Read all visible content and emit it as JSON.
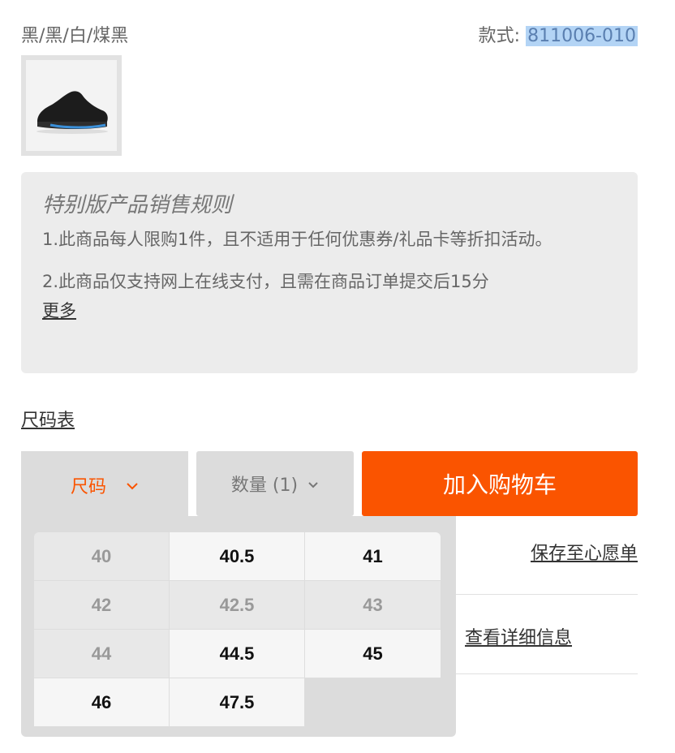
{
  "product": {
    "colorway": "黑/黑/白/煤黑",
    "style_label": "款式: ",
    "style_code": "811006-010"
  },
  "rules": {
    "title": "特别版产品销售规则",
    "items": [
      "1.此商品每人限购1件，且不适用于任何优惠券/礼品卡等折扣活动。",
      "2.此商品仅支持网上在线支付，且需在商品订单提交后15分"
    ],
    "more_label": "更多"
  },
  "size_chart_label": "尺码表",
  "controls": {
    "size_label": "尺码",
    "quantity_label": "数量 (1)",
    "add_to_cart_label": "加入购物车",
    "accent_color": "#fa5400"
  },
  "links": {
    "wishlist": "保存至心愿单",
    "details": "查看详细信息"
  },
  "sizes": [
    {
      "label": "40",
      "available": false
    },
    {
      "label": "40.5",
      "available": true
    },
    {
      "label": "41",
      "available": true
    },
    {
      "label": "42",
      "available": false
    },
    {
      "label": "42.5",
      "available": false
    },
    {
      "label": "43",
      "available": false
    },
    {
      "label": "44",
      "available": false
    },
    {
      "label": "44.5",
      "available": true
    },
    {
      "label": "45",
      "available": true
    },
    {
      "label": "46",
      "available": true
    },
    {
      "label": "47.5",
      "available": true
    }
  ],
  "icons": {
    "chevron": "chevron-down-icon"
  }
}
